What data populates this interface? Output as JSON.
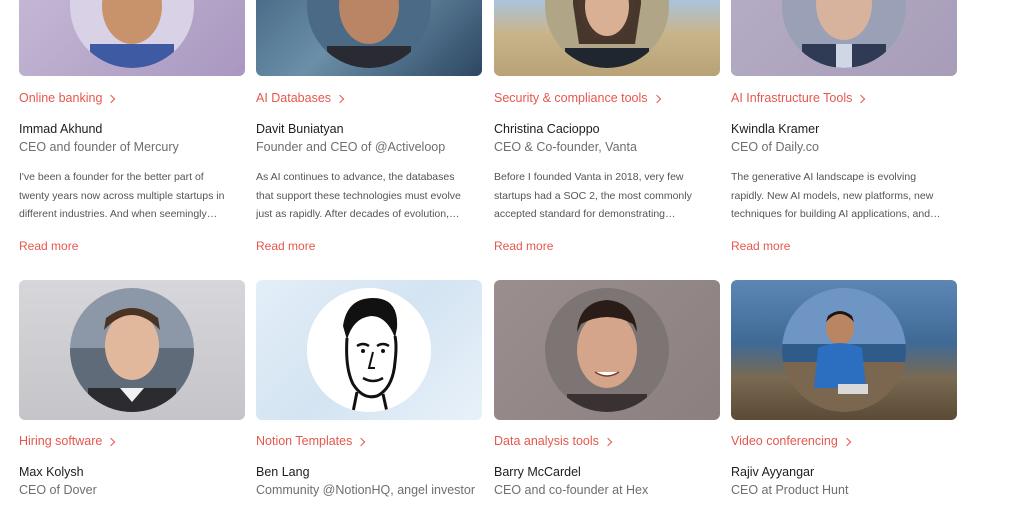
{
  "cards": [
    {
      "category": "Online banking",
      "name": "Immad Akhund",
      "role": "CEO and founder of Mercury",
      "excerpt_lines": [
        "I've been a founder for the better part of",
        "twenty years now across multiple startups in",
        "different industries. And when seemingly…"
      ],
      "read_more": "Read more"
    },
    {
      "category": "AI Databases",
      "name": "Davit Buniatyan",
      "role": "Founder and CEO of @Activeloop",
      "excerpt_lines": [
        "As AI continues to advance, the databases",
        "that support these technologies must evolve",
        "just as rapidly. After decades of evolution,…"
      ],
      "read_more": "Read more"
    },
    {
      "category": "Security & compliance tools",
      "name": "Christina Cacioppo",
      "role": "CEO & Co-founder, Vanta",
      "excerpt_lines": [
        "Before I founded Vanta in 2018, very few",
        "startups had a SOC 2, the most commonly",
        "accepted standard for demonstrating…"
      ],
      "read_more": "Read more"
    },
    {
      "category": "AI Infrastructure Tools",
      "name": "Kwindla Kramer",
      "role": "CEO of Daily.co",
      "excerpt_lines": [
        "The generative AI landscape is evolving",
        "rapidly. New AI models, new platforms, new",
        "techniques for building AI applications, and…"
      ],
      "read_more": "Read more"
    },
    {
      "category": "Hiring software",
      "name": "Max Kolysh",
      "role": "CEO of Dover"
    },
    {
      "category": "Notion Templates",
      "name": "Ben Lang",
      "role": "Community @NotionHQ, angel investor"
    },
    {
      "category": "Data analysis tools",
      "name": "Barry McCardel",
      "role": "CEO and co-founder at Hex"
    },
    {
      "category": "Video conferencing",
      "name": "Rajiv Ayyangar",
      "role": "CEO at Product Hunt"
    }
  ],
  "colors": {
    "accent": "#e6574d",
    "name_text": "#1d1d1f",
    "role_text": "#6e6e73",
    "body_text": "#555558"
  },
  "icons": {
    "category_link": "chevron-right-icon"
  }
}
